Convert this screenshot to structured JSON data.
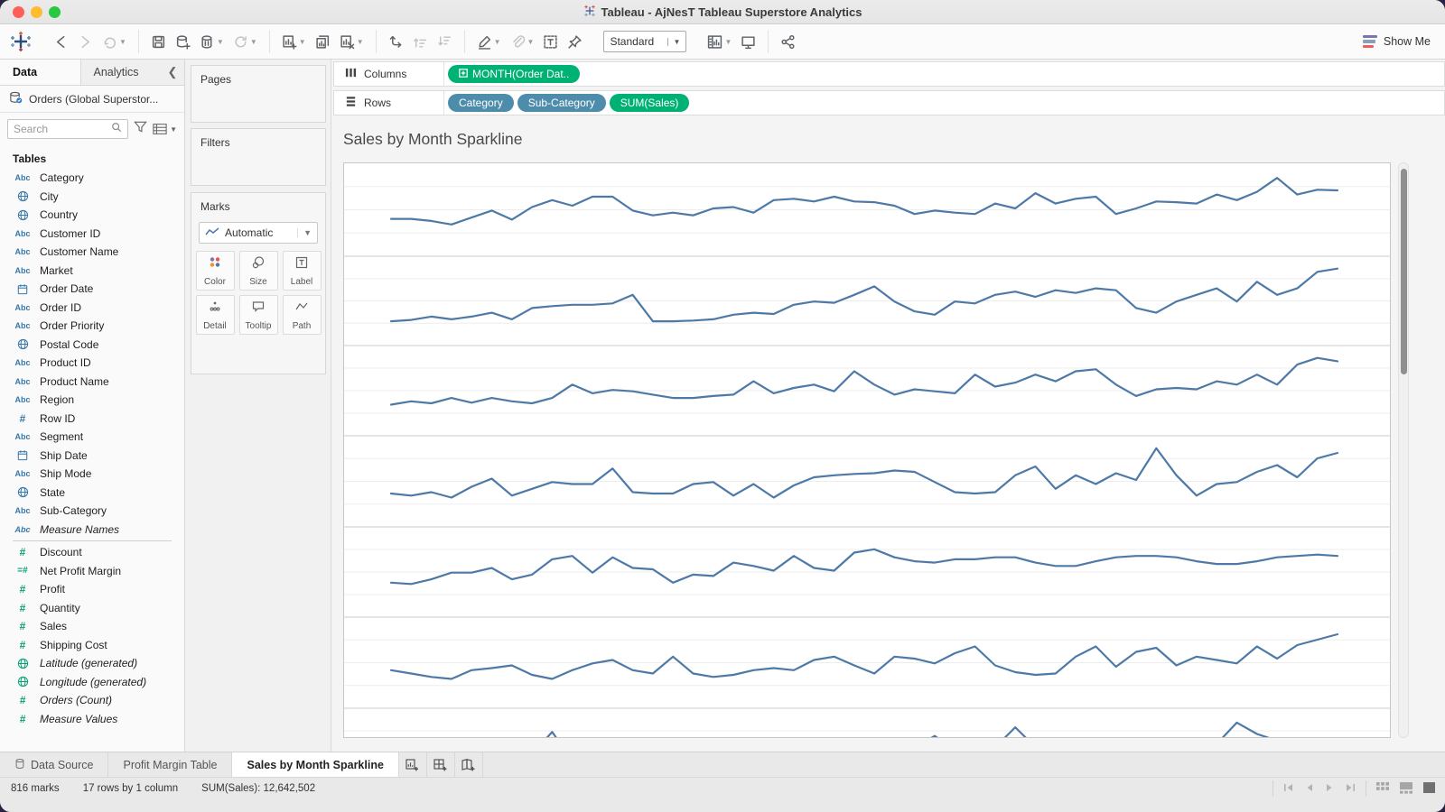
{
  "window": {
    "title": "Tableau - AjNesT Tableau Superstore Analytics"
  },
  "toolbar": {
    "standard_label": "Standard",
    "show_me_label": "Show Me",
    "show_me_colors": [
      "#7b74b4",
      "#8aa0b4",
      "#ef5b5f"
    ],
    "groups": [
      [
        {
          "icon": "back-arrow",
          "disabled": false,
          "caret": false
        },
        {
          "icon": "forward-arrow",
          "disabled": true,
          "caret": false
        },
        {
          "icon": "redo-arrow",
          "disabled": true,
          "caret": true
        }
      ],
      [
        {
          "icon": "save",
          "disabled": false,
          "caret": false
        },
        {
          "icon": "new-data-source",
          "disabled": false,
          "caret": false
        },
        {
          "icon": "pause-data-updates",
          "disabled": false,
          "caret": true
        },
        {
          "icon": "refresh-data",
          "disabled": true,
          "caret": true
        }
      ],
      [
        {
          "icon": "new-worksheet",
          "disabled": false,
          "caret": true
        },
        {
          "icon": "duplicate-sheet",
          "disabled": false,
          "caret": false
        },
        {
          "icon": "clear-sheet",
          "disabled": false,
          "caret": true
        }
      ],
      [
        {
          "icon": "swap-rows-columns",
          "disabled": false,
          "caret": false
        },
        {
          "icon": "sort-ascending",
          "disabled": true,
          "caret": false
        },
        {
          "icon": "sort-descending",
          "disabled": true,
          "caret": false
        }
      ],
      [
        {
          "icon": "highlight",
          "disabled": false,
          "caret": true
        },
        {
          "icon": "attach",
          "disabled": true,
          "caret": true
        },
        {
          "icon": "text-label",
          "disabled": false,
          "caret": false
        },
        {
          "icon": "fix-axes-pin",
          "disabled": false,
          "caret": false
        }
      ]
    ],
    "groups_right": [
      [
        {
          "icon": "show-hide-cards",
          "disabled": false,
          "caret": true
        },
        {
          "icon": "presentation-mode",
          "disabled": false,
          "caret": false
        }
      ],
      [
        {
          "icon": "share",
          "disabled": false,
          "caret": false
        }
      ]
    ]
  },
  "sidebar": {
    "tabs": [
      {
        "label": "Data",
        "active": true
      },
      {
        "label": "Analytics",
        "active": false
      }
    ],
    "datasource": "Orders (Global Superstor...",
    "search_placeholder": "Search",
    "tables_label": "Tables",
    "fields": [
      {
        "label": "Category",
        "icon": "abc",
        "role": "dim"
      },
      {
        "label": "City",
        "icon": "globe",
        "role": "dim"
      },
      {
        "label": "Country",
        "icon": "globe",
        "role": "dim"
      },
      {
        "label": "Customer ID",
        "icon": "abc",
        "role": "dim"
      },
      {
        "label": "Customer Name",
        "icon": "abc",
        "role": "dim"
      },
      {
        "label": "Market",
        "icon": "abc",
        "role": "dim"
      },
      {
        "label": "Order Date",
        "icon": "calendar",
        "role": "dim"
      },
      {
        "label": "Order ID",
        "icon": "abc",
        "role": "dim"
      },
      {
        "label": "Order Priority",
        "icon": "abc",
        "role": "dim"
      },
      {
        "label": "Postal Code",
        "icon": "globe",
        "role": "dim"
      },
      {
        "label": "Product ID",
        "icon": "abc",
        "role": "dim"
      },
      {
        "label": "Product Name",
        "icon": "abc",
        "role": "dim"
      },
      {
        "label": "Region",
        "icon": "abc",
        "role": "dim"
      },
      {
        "label": "Row ID",
        "icon": "hash",
        "role": "dim"
      },
      {
        "label": "Segment",
        "icon": "abc",
        "role": "dim"
      },
      {
        "label": "Ship Date",
        "icon": "calendar",
        "role": "dim"
      },
      {
        "label": "Ship Mode",
        "icon": "abc",
        "role": "dim"
      },
      {
        "label": "State",
        "icon": "globe",
        "role": "dim"
      },
      {
        "label": "Sub-Category",
        "icon": "abc",
        "role": "dim"
      },
      {
        "label": "Measure Names",
        "icon": "abc",
        "role": "dim",
        "italic": true,
        "separator_after": true
      },
      {
        "label": "Discount",
        "icon": "hash",
        "role": "measure"
      },
      {
        "label": "Net Profit Margin",
        "icon": "calc",
        "role": "measure"
      },
      {
        "label": "Profit",
        "icon": "hash",
        "role": "measure"
      },
      {
        "label": "Quantity",
        "icon": "hash",
        "role": "measure"
      },
      {
        "label": "Sales",
        "icon": "hash",
        "role": "measure"
      },
      {
        "label": "Shipping Cost",
        "icon": "hash",
        "role": "measure"
      },
      {
        "label": "Latitude (generated)",
        "icon": "globe",
        "role": "measure",
        "italic": true
      },
      {
        "label": "Longitude (generated)",
        "icon": "globe",
        "role": "measure",
        "italic": true
      },
      {
        "label": "Orders (Count)",
        "icon": "hash",
        "role": "measure",
        "italic": true
      },
      {
        "label": "Measure Values",
        "icon": "hash",
        "role": "measure",
        "italic": true
      }
    ]
  },
  "cards": {
    "pages_label": "Pages",
    "filters_label": "Filters",
    "marks": {
      "title": "Marks",
      "mark_type": "Automatic",
      "buttons": [
        {
          "label": "Color",
          "icon": "color"
        },
        {
          "label": "Size",
          "icon": "size"
        },
        {
          "label": "Label",
          "icon": "label"
        },
        {
          "label": "Detail",
          "icon": "detail"
        },
        {
          "label": "Tooltip",
          "icon": "tooltip"
        },
        {
          "label": "Path",
          "icon": "path"
        }
      ]
    }
  },
  "shelves": {
    "columns": {
      "label": "Columns",
      "pills": [
        {
          "text": "MONTH(Order Dat..",
          "type": "green",
          "icon": "plus-box"
        }
      ]
    },
    "rows": {
      "label": "Rows",
      "pills": [
        {
          "text": "Category",
          "type": "blue"
        },
        {
          "text": "Sub-Category",
          "type": "blue"
        },
        {
          "text": "SUM(Sales)",
          "type": "green"
        }
      ]
    }
  },
  "sheet": {
    "title": "Sales by Month Sparkline"
  },
  "chart_data": {
    "type": "line",
    "title": "Sales by Month Sparkline",
    "x": "Month of Order Date (continuous, 48 months)",
    "ylabel": "SUM(Sales) per Category / Sub-Category row (independent scales, axis headers hidden)",
    "grid": "faint horizontal gridlines per row panel",
    "legend": "none",
    "line_color": "#4e79a7",
    "visible_rows": 7,
    "total_rows_note": "17 rows by 1 column (scrolled, 7 panels visible)",
    "series": [
      {
        "name": "row-1",
        "values": [
          0.33,
          0.33,
          0.3,
          0.25,
          0.35,
          0.45,
          0.32,
          0.5,
          0.6,
          0.52,
          0.65,
          0.65,
          0.45,
          0.38,
          0.42,
          0.38,
          0.48,
          0.5,
          0.42,
          0.6,
          0.62,
          0.58,
          0.65,
          0.58,
          0.57,
          0.52,
          0.4,
          0.45,
          0.42,
          0.4,
          0.55,
          0.48,
          0.7,
          0.55,
          0.62,
          0.65,
          0.4,
          0.48,
          0.58,
          0.57,
          0.55,
          0.68,
          0.6,
          0.72,
          0.92,
          0.68,
          0.75,
          0.74
        ]
      },
      {
        "name": "row-2",
        "values": [
          0.15,
          0.17,
          0.22,
          0.18,
          0.22,
          0.28,
          0.18,
          0.35,
          0.38,
          0.4,
          0.4,
          0.42,
          0.55,
          0.15,
          0.15,
          0.16,
          0.18,
          0.25,
          0.28,
          0.26,
          0.4,
          0.45,
          0.43,
          0.55,
          0.68,
          0.45,
          0.3,
          0.25,
          0.45,
          0.42,
          0.55,
          0.6,
          0.52,
          0.62,
          0.58,
          0.65,
          0.62,
          0.35,
          0.28,
          0.45,
          0.55,
          0.65,
          0.45,
          0.75,
          0.55,
          0.65,
          0.9,
          0.95
        ]
      },
      {
        "name": "row-3",
        "values": [
          0.25,
          0.3,
          0.27,
          0.35,
          0.28,
          0.35,
          0.3,
          0.27,
          0.35,
          0.55,
          0.42,
          0.47,
          0.45,
          0.4,
          0.35,
          0.35,
          0.38,
          0.4,
          0.6,
          0.42,
          0.5,
          0.55,
          0.45,
          0.75,
          0.55,
          0.4,
          0.48,
          0.45,
          0.42,
          0.7,
          0.52,
          0.58,
          0.7,
          0.6,
          0.75,
          0.78,
          0.55,
          0.38,
          0.48,
          0.5,
          0.48,
          0.6,
          0.55,
          0.7,
          0.55,
          0.85,
          0.95,
          0.9
        ]
      },
      {
        "name": "row-4",
        "values": [
          0.28,
          0.25,
          0.3,
          0.22,
          0.38,
          0.5,
          0.25,
          0.35,
          0.45,
          0.42,
          0.42,
          0.65,
          0.3,
          0.28,
          0.28,
          0.42,
          0.45,
          0.25,
          0.42,
          0.22,
          0.4,
          0.52,
          0.55,
          0.57,
          0.58,
          0.62,
          0.6,
          0.45,
          0.3,
          0.28,
          0.3,
          0.55,
          0.68,
          0.35,
          0.55,
          0.42,
          0.58,
          0.48,
          0.95,
          0.55,
          0.25,
          0.42,
          0.45,
          0.6,
          0.7,
          0.52,
          0.8,
          0.88
        ]
      },
      {
        "name": "row-5",
        "values": [
          0.3,
          0.28,
          0.35,
          0.45,
          0.45,
          0.52,
          0.35,
          0.42,
          0.65,
          0.7,
          0.45,
          0.68,
          0.52,
          0.5,
          0.3,
          0.42,
          0.4,
          0.6,
          0.55,
          0.48,
          0.7,
          0.52,
          0.48,
          0.75,
          0.8,
          0.68,
          0.62,
          0.6,
          0.65,
          0.65,
          0.68,
          0.68,
          0.6,
          0.55,
          0.55,
          0.62,
          0.68,
          0.7,
          0.7,
          0.68,
          0.62,
          0.58,
          0.58,
          0.62,
          0.68,
          0.7,
          0.72,
          0.7
        ]
      },
      {
        "name": "row-6",
        "values": [
          0.35,
          0.3,
          0.25,
          0.22,
          0.35,
          0.38,
          0.42,
          0.28,
          0.22,
          0.35,
          0.45,
          0.5,
          0.35,
          0.3,
          0.55,
          0.3,
          0.25,
          0.28,
          0.35,
          0.38,
          0.35,
          0.5,
          0.55,
          0.42,
          0.3,
          0.55,
          0.52,
          0.45,
          0.6,
          0.7,
          0.42,
          0.32,
          0.28,
          0.3,
          0.55,
          0.7,
          0.4,
          0.62,
          0.68,
          0.42,
          0.55,
          0.5,
          0.45,
          0.7,
          0.52,
          0.72,
          0.8,
          0.88
        ]
      },
      {
        "name": "row-7",
        "values": [
          0.2,
          0.25,
          0.22,
          0.3,
          0.28,
          0.35,
          0.3,
          0.45,
          0.78,
          0.35,
          0.3,
          0.32,
          0.35,
          0.3,
          0.28,
          0.35,
          0.4,
          0.38,
          0.42,
          0.4,
          0.45,
          0.42,
          0.48,
          0.5,
          0.45,
          0.5,
          0.55,
          0.72,
          0.5,
          0.45,
          0.55,
          0.85,
          0.55,
          0.5,
          0.52,
          0.55,
          0.5,
          0.55,
          0.6,
          0.55,
          0.5,
          0.6,
          0.92,
          0.75,
          0.65,
          0.6,
          0.58,
          0.55
        ]
      }
    ]
  },
  "bottom_tabs": [
    {
      "label": "Data Source",
      "icon": "datasource",
      "active": false
    },
    {
      "label": "Profit Margin Table",
      "active": false
    },
    {
      "label": "Sales by Month Sparkline",
      "active": true
    }
  ],
  "new_tab_buttons": [
    {
      "icon": "new-worksheet-tab"
    },
    {
      "icon": "new-dashboard-tab"
    },
    {
      "icon": "new-story-tab"
    }
  ],
  "status_bar": {
    "marks": "816 marks",
    "dimensions": "17 rows by 1 column",
    "aggregate": "SUM(Sales): 12,642,502"
  },
  "colors": {
    "pill_green": "#00b174",
    "pill_blue": "#4e8cab",
    "sparkline": "#4e79a7",
    "dimension_icon": "#3678a9",
    "measure_icon": "#0ba077"
  }
}
